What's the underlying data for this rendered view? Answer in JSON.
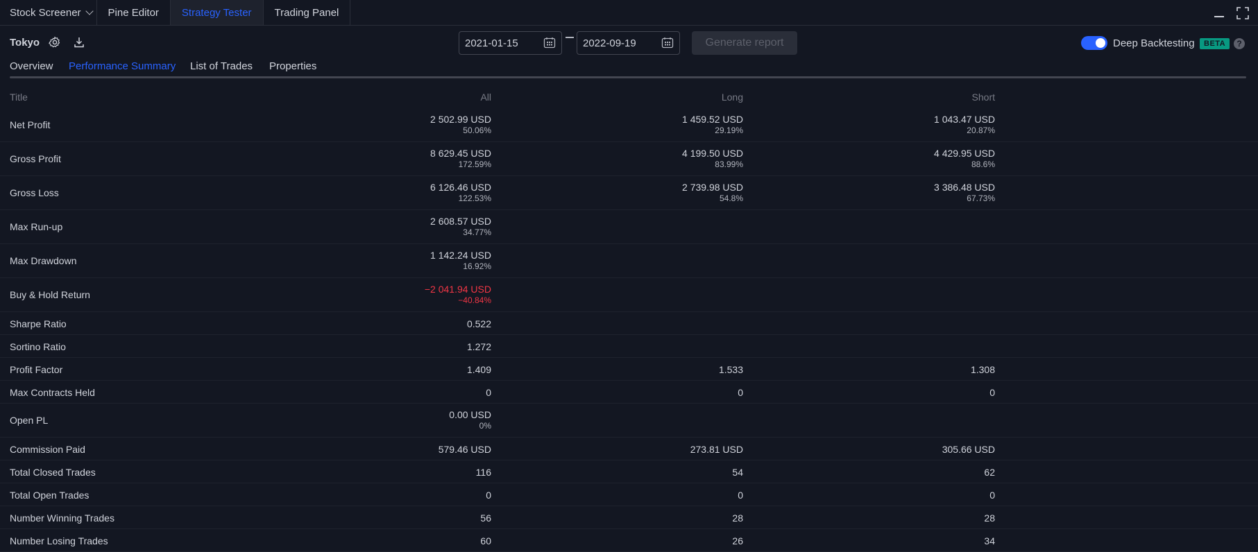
{
  "top_tabs": {
    "stock_screener": "Stock Screener",
    "pine_editor": "Pine Editor",
    "strategy_tester": "Strategy Tester",
    "trading_panel": "Trading Panel"
  },
  "toolbar": {
    "strategy_name": "Tokyo",
    "date_from": "2021-01-15",
    "date_to": "2022-09-19",
    "generate_label": "Generate report",
    "deep_backtesting_label": "Deep Backtesting",
    "deep_backtesting_on": true,
    "beta_label": "BETA",
    "help_label": "?"
  },
  "sub_tabs": [
    "Overview",
    "Performance Summary",
    "List of Trades",
    "Properties"
  ],
  "active_sub_tab": "Performance Summary",
  "table": {
    "headers": {
      "title": "Title",
      "all": "All",
      "long": "Long",
      "short": "Short"
    },
    "rows": [
      {
        "title": "Net Profit",
        "all": "2 502.99 USD",
        "all_pct": "50.06%",
        "long": "1 459.52 USD",
        "long_pct": "29.19%",
        "short": "1 043.47 USD",
        "short_pct": "20.87%"
      },
      {
        "title": "Gross Profit",
        "all": "8 629.45 USD",
        "all_pct": "172.59%",
        "long": "4 199.50 USD",
        "long_pct": "83.99%",
        "short": "4 429.95 USD",
        "short_pct": "88.6%"
      },
      {
        "title": "Gross Loss",
        "all": "6 126.46 USD",
        "all_pct": "122.53%",
        "long": "2 739.98 USD",
        "long_pct": "54.8%",
        "short": "3 386.48 USD",
        "short_pct": "67.73%"
      },
      {
        "title": "Max Run-up",
        "all": "2 608.57 USD",
        "all_pct": "34.77%"
      },
      {
        "title": "Max Drawdown",
        "all": "1 142.24 USD",
        "all_pct": "16.92%"
      },
      {
        "title": "Buy & Hold Return",
        "all": "−2 041.94 USD",
        "all_pct": "−40.84%"
      },
      {
        "title": "Sharpe Ratio",
        "all": "0.522"
      },
      {
        "title": "Sortino Ratio",
        "all": "1.272"
      },
      {
        "title": "Profit Factor",
        "all": "1.409",
        "long": "1.533",
        "short": "1.308"
      },
      {
        "title": "Max Contracts Held",
        "all": "0",
        "long": "0",
        "short": "0"
      },
      {
        "title": "Open PL",
        "all": "0.00 USD",
        "all_pct": "0%"
      },
      {
        "title": "Commission Paid",
        "all": "579.46 USD",
        "long": "273.81 USD",
        "short": "305.66 USD"
      },
      {
        "title": "Total Closed Trades",
        "all": "116",
        "long": "54",
        "short": "62"
      },
      {
        "title": "Total Open Trades",
        "all": "0",
        "long": "0",
        "short": "0"
      },
      {
        "title": "Number Winning Trades",
        "all": "56",
        "long": "28",
        "short": "28"
      },
      {
        "title": "Number Losing Trades",
        "all": "60",
        "long": "26",
        "short": "34"
      }
    ]
  },
  "colors": {
    "background": "#131722",
    "accent": "#2962ff",
    "negative": "#f23645",
    "beta": "#089981"
  }
}
